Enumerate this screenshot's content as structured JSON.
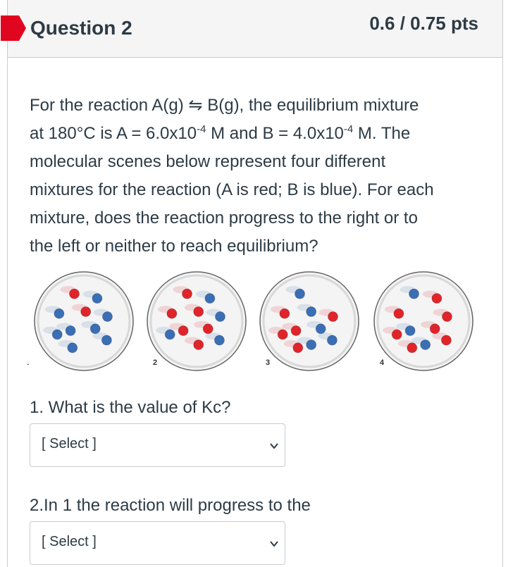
{
  "question": {
    "title": "Question 2",
    "points": "0.6 / 0.75 pts",
    "flag_color": "#e0061f"
  },
  "stem": {
    "line1_a": "For the reaction A(g) ",
    "arrow": "⇋",
    "line1_b": " B(g), the equilibrium mixture",
    "line2_a": "at 180°C is A = 6.0x10",
    "exp1": "-4",
    "line2_b": " M and B = 4.0x10",
    "exp2": "-4",
    "line2_c": " M.  The",
    "line3": "molecular scenes below represent four different",
    "line4": "mixtures for the reaction (A is red; B is blue).  For each",
    "line5": "mixture, does the reaction progress to the right or to",
    "line6": "the left or neither to reach equilibrium?"
  },
  "figure": {
    "colors": {
      "A": "#e0242a",
      "B": "#3a6fb5"
    },
    "scenes": [
      {
        "label": "1",
        "red": 2,
        "blue": 8
      },
      {
        "label": "2",
        "red": 6,
        "blue": 4
      },
      {
        "label": "3",
        "red": 5,
        "blue": 5
      },
      {
        "label": "4",
        "red": 7,
        "blue": 3
      }
    ]
  },
  "subquestions": [
    {
      "label": "1. What is the value of Kc?",
      "select_value": "[ Select ]"
    },
    {
      "label": "2.In 1 the reaction will progress to the",
      "select_value": "[ Select ]"
    }
  ]
}
